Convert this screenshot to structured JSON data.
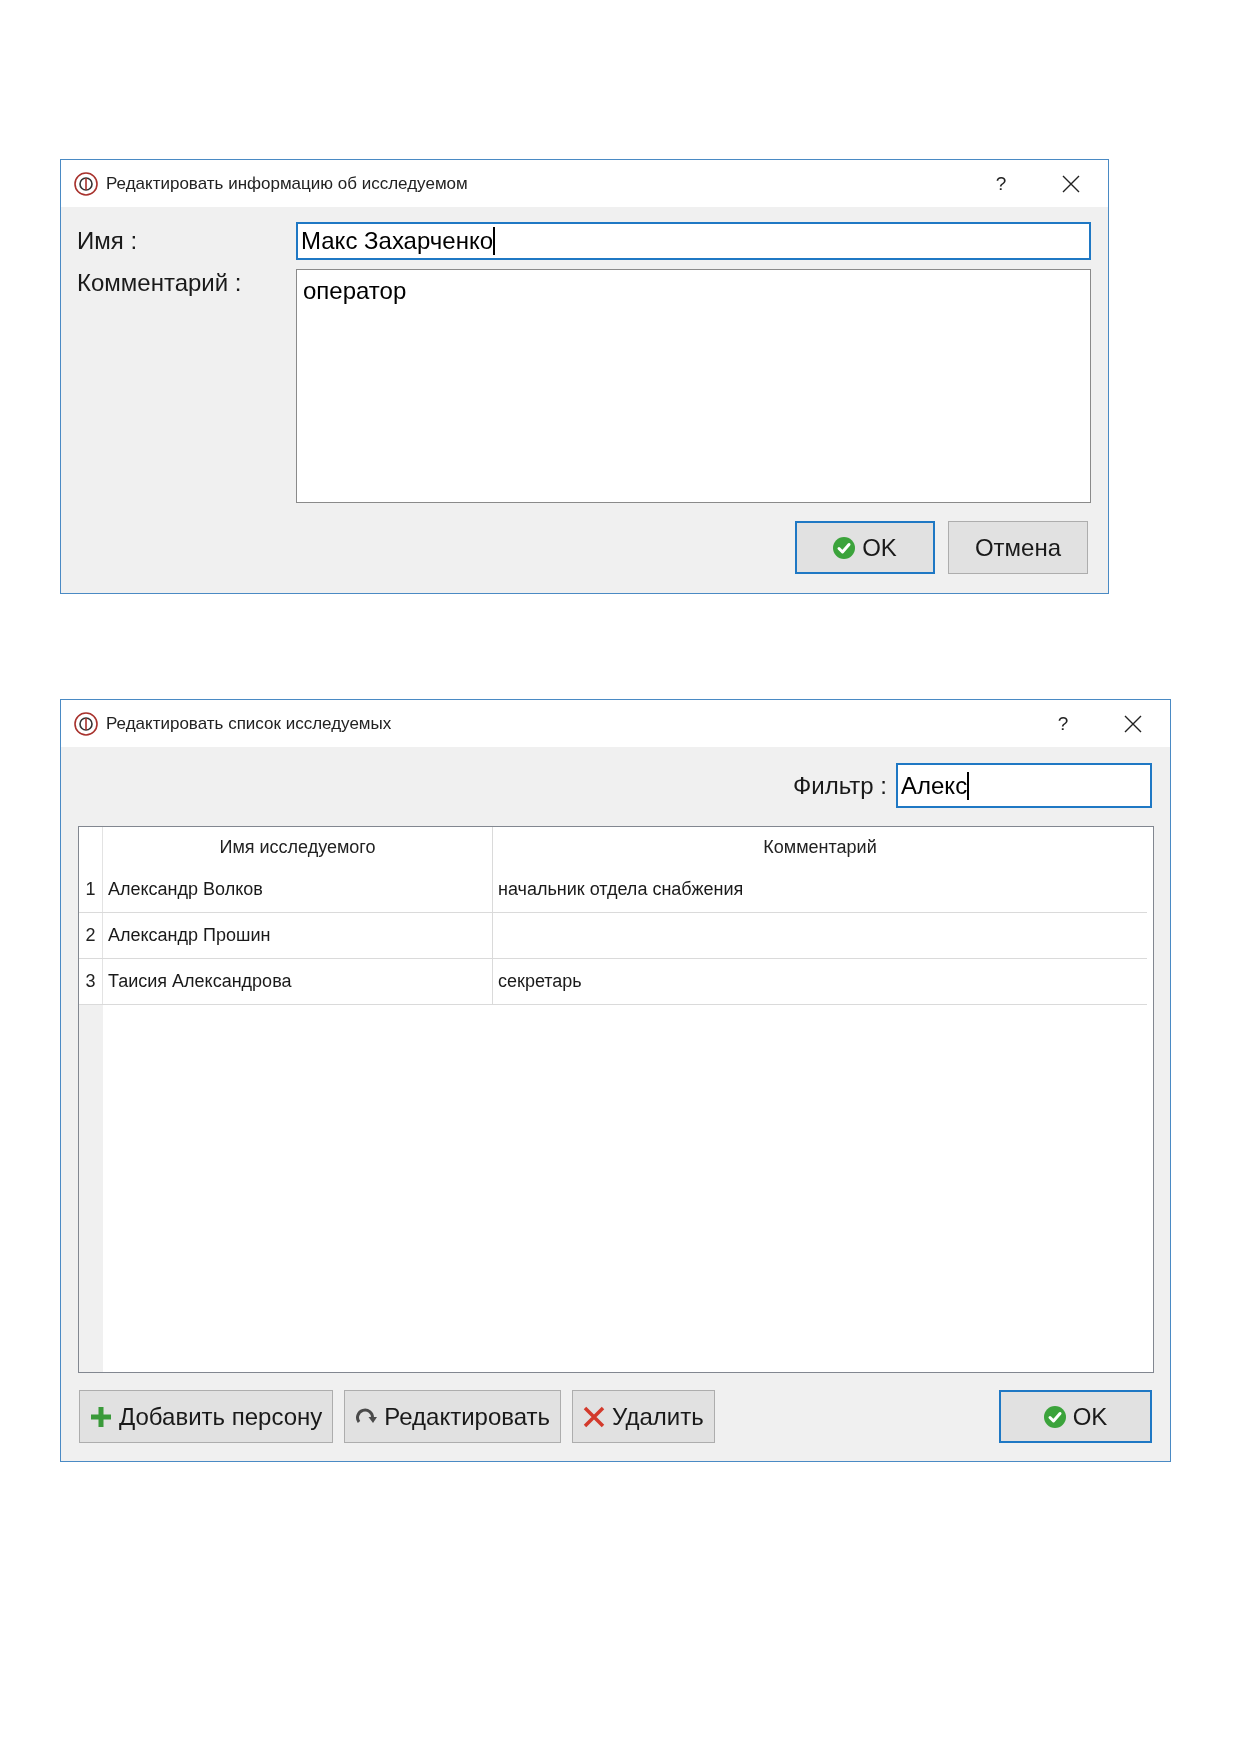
{
  "dialogs": [
    {
      "kind": "person_form",
      "title": "Редактировать информацию об исследуемом",
      "help_button": "?",
      "fields": [
        {
          "kind": "line",
          "label": "Имя :",
          "value": "Макс Захарченко",
          "focused": true
        },
        {
          "kind": "multiline",
          "label": "Комментарий :",
          "value": "оператор",
          "focused": false
        }
      ],
      "buttons": [
        {
          "kind": "confirm",
          "label": "OK",
          "default": true
        },
        {
          "kind": "cancel",
          "label": "Отмена",
          "default": false
        }
      ]
    },
    {
      "kind": "person_list",
      "title": "Редактировать список исследуемых",
      "help_button": "?",
      "filter": {
        "label": "Фильтр :",
        "value": "Алекс",
        "focused": true
      },
      "table": {
        "columns": [
          "Имя исследуемого",
          "Комментарий"
        ],
        "rows": [
          {
            "number": "1",
            "name": "Александр Волков",
            "comment": "начальник отдела снабжения",
            "selected": false
          },
          {
            "number": "2",
            "name": "Александр Прошин",
            "selected": false
          },
          {
            "number": "3",
            "name": "Таисия Александрова",
            "comment": "секретарь",
            "selected": false
          }
        ]
      },
      "buttons": [
        {
          "kind": "add",
          "label": "Добавить персону",
          "default": false
        },
        {
          "kind": "edit",
          "label": "Редактировать",
          "default": false
        },
        {
          "kind": "delete",
          "label": "Удалить",
          "default": false
        },
        {
          "kind": "confirm",
          "label": "OK",
          "default": true
        }
      ]
    }
  ]
}
